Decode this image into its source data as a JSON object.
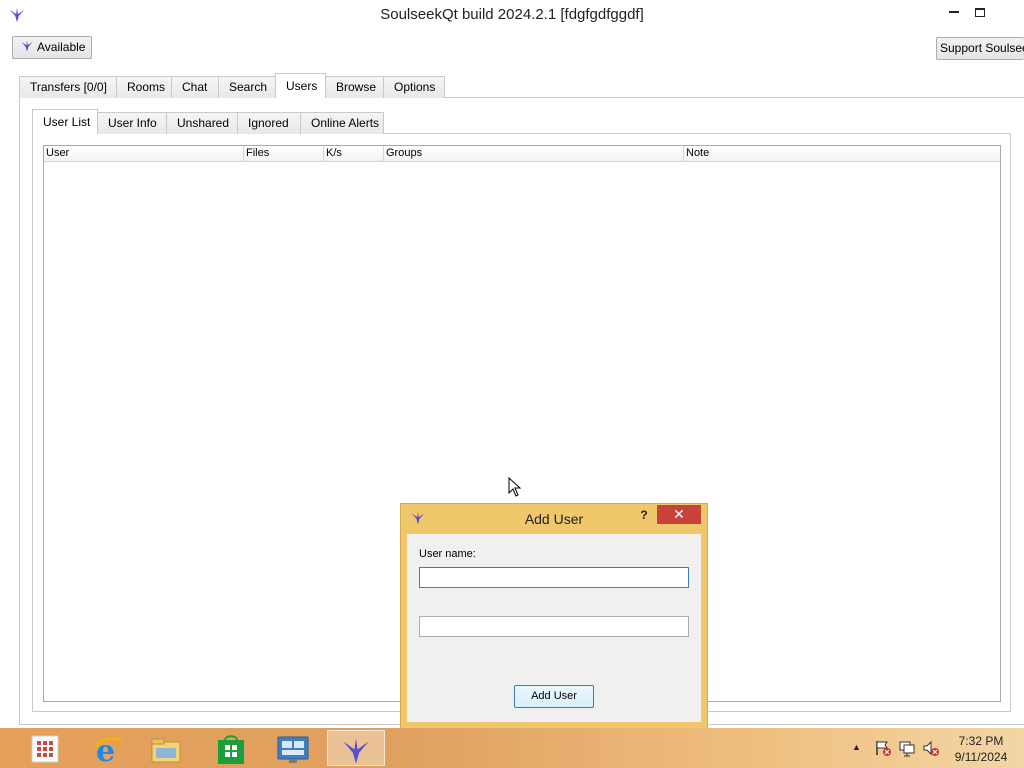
{
  "window": {
    "title": "SoulseekQt build 2024.2.1 [fdgfgdfggdf]"
  },
  "toolbar": {
    "status_button": "Available",
    "support_button": "Support Soulseek"
  },
  "main_tabs": [
    {
      "label": "Transfers [0/0]"
    },
    {
      "label": "Rooms"
    },
    {
      "label": "Chat"
    },
    {
      "label": "Search"
    },
    {
      "label": "Users",
      "active": true
    },
    {
      "label": "Browse"
    },
    {
      "label": "Options"
    }
  ],
  "users_tabs": [
    {
      "label": "User List",
      "active": true
    },
    {
      "label": "User Info"
    },
    {
      "label": "Unshared"
    },
    {
      "label": "Ignored"
    },
    {
      "label": "Online Alerts"
    }
  ],
  "user_table": {
    "columns": [
      "User",
      "Files",
      "K/s",
      "Groups",
      "Note"
    ],
    "rows": []
  },
  "dialog": {
    "title": "Add User",
    "help_label": "?",
    "close_label": "✕",
    "username_label": "User name:",
    "username_value": "",
    "second_field_value": "",
    "add_button": "Add User"
  },
  "taskbar": {
    "apps": [
      {
        "icon": "start-grid-icon"
      },
      {
        "icon": "internet-explorer-icon"
      },
      {
        "icon": "file-explorer-icon"
      },
      {
        "icon": "windows-store-icon"
      },
      {
        "icon": "remote-desktop-icon"
      },
      {
        "icon": "soulseek-icon",
        "active": true
      }
    ],
    "tray_chevron": "▲",
    "time": "7:32 PM",
    "date": "9/11/2024"
  },
  "colors": {
    "dialog_frame": "#f0c76a",
    "close_button": "#c7423b",
    "taskbar": "#e5a05a"
  }
}
